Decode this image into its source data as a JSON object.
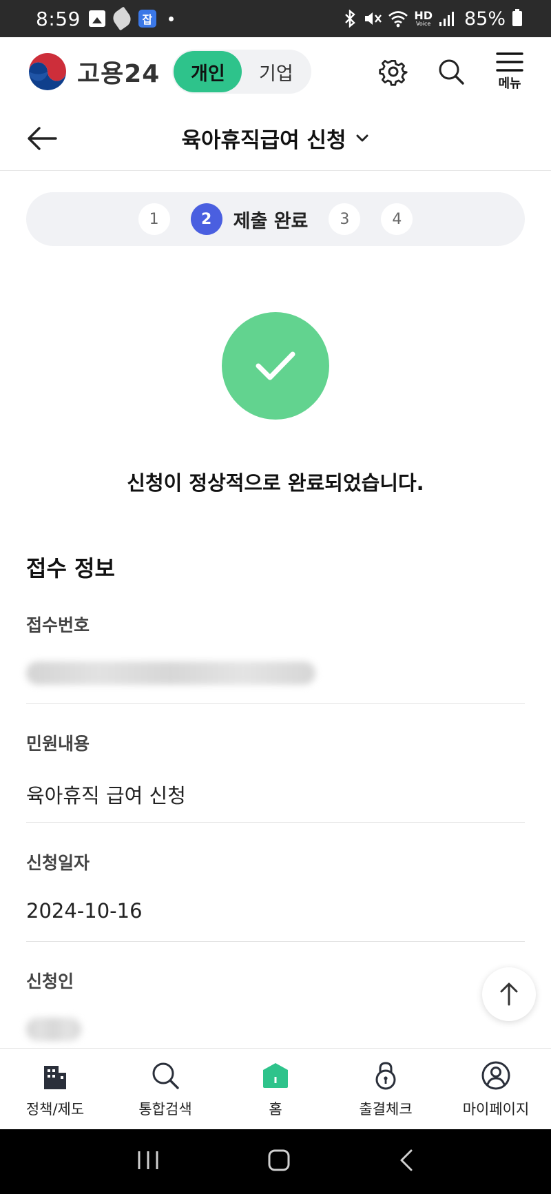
{
  "status_bar": {
    "time": "8:59",
    "app_badge": "잡",
    "network": "HD",
    "network_sub": "Voice",
    "battery": "85%"
  },
  "header": {
    "logo_text": "고용24",
    "toggle": {
      "personal": "개인",
      "company": "기업"
    },
    "menu_label": "메뉴"
  },
  "page": {
    "title": "육아휴직급여 신청"
  },
  "stepper": {
    "steps": [
      "1",
      "2",
      "3",
      "4"
    ],
    "active_label": "제출 완료"
  },
  "success": {
    "message": "신청이 정상적으로 완료되었습니다."
  },
  "receipt": {
    "section_title": "접수 정보",
    "fields": [
      {
        "label": "접수번호",
        "value": ""
      },
      {
        "label": "민원내용",
        "value": "육아휴직 급여 신청"
      },
      {
        "label": "신청일자",
        "value": "2024-10-16"
      },
      {
        "label": "신청인",
        "value": ""
      }
    ]
  },
  "bottom_nav": {
    "items": [
      "정책/제도",
      "통합검색",
      "홈",
      "출결체크",
      "마이페이지"
    ]
  },
  "colors": {
    "brand_green": "#2ec38b",
    "success_green": "#62d38f",
    "step_active": "#4a5fe0"
  },
  "icons": {
    "settings": "gear-icon",
    "search": "search-icon",
    "menu": "hamburger-icon",
    "back": "arrow-left-icon",
    "dropdown": "chevron-down-icon",
    "success": "check-icon",
    "scroll_top": "arrow-up-icon"
  }
}
